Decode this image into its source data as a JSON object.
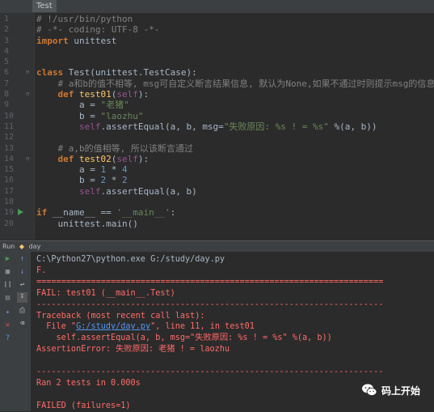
{
  "tab": {
    "label": "Test"
  },
  "editor": {
    "line_numbers": [
      "1",
      "2",
      "3",
      "4",
      "5",
      "6",
      "7",
      "8",
      "9",
      "10",
      "11",
      "12",
      "13",
      "14",
      "15",
      "16",
      "17",
      "18",
      "19",
      "20"
    ],
    "lines": [
      [
        {
          "c": "cm",
          "t": "# !/usr/bin/python"
        }
      ],
      [
        {
          "c": "cm",
          "t": "# -*- coding: UTF-8 -*-"
        }
      ],
      [
        {
          "c": "kw",
          "t": "import"
        },
        {
          "c": "",
          "t": " unittest"
        }
      ],
      [],
      [],
      [
        {
          "c": "kw",
          "t": "class"
        },
        {
          "c": "",
          "t": " Test(unittest.TestCase):"
        }
      ],
      [
        {
          "c": "cm",
          "t": "    # a和b的值不相等, msg可自定义断言结果信息, 默认为None,如果不通过时则提示msg的信息"
        }
      ],
      [
        {
          "c": "",
          "t": "    "
        },
        {
          "c": "kw",
          "t": "def"
        },
        {
          "c": "",
          "t": " "
        },
        {
          "c": "fn",
          "t": "test01"
        },
        {
          "c": "",
          "t": "("
        },
        {
          "c": "sf",
          "t": "self"
        },
        {
          "c": "",
          "t": "):"
        }
      ],
      [
        {
          "c": "",
          "t": "        a = "
        },
        {
          "c": "st",
          "t": "\"老猪\""
        }
      ],
      [
        {
          "c": "",
          "t": "        b = "
        },
        {
          "c": "st",
          "t": "\"laozhu\""
        }
      ],
      [
        {
          "c": "",
          "t": "        "
        },
        {
          "c": "sf",
          "t": "self"
        },
        {
          "c": "",
          "t": ".assertEqual(a, b, msg="
        },
        {
          "c": "st",
          "t": "\"失败原因: %s ! = %s\""
        },
        {
          "c": "",
          "t": " %(a, b))"
        }
      ],
      [],
      [
        {
          "c": "cm",
          "t": "    # a,b的值相等, 所以该断言通过"
        }
      ],
      [
        {
          "c": "",
          "t": "    "
        },
        {
          "c": "kw",
          "t": "def"
        },
        {
          "c": "",
          "t": " "
        },
        {
          "c": "fn",
          "t": "test02"
        },
        {
          "c": "",
          "t": "("
        },
        {
          "c": "sf",
          "t": "self"
        },
        {
          "c": "",
          "t": "):"
        }
      ],
      [
        {
          "c": "",
          "t": "        a = "
        },
        {
          "c": "nu",
          "t": "1"
        },
        {
          "c": "",
          "t": " * "
        },
        {
          "c": "nu",
          "t": "4"
        }
      ],
      [
        {
          "c": "",
          "t": "        b = "
        },
        {
          "c": "nu",
          "t": "2"
        },
        {
          "c": "",
          "t": " * "
        },
        {
          "c": "nu",
          "t": "2"
        }
      ],
      [
        {
          "c": "",
          "t": "        "
        },
        {
          "c": "sf",
          "t": "self"
        },
        {
          "c": "",
          "t": ".assertEqual(a, b)"
        }
      ],
      [],
      [
        {
          "c": "kw",
          "t": "if"
        },
        {
          "c": "",
          "t": " __name__ == "
        },
        {
          "c": "st",
          "t": "'__main__'"
        },
        {
          "c": "",
          "t": ":"
        }
      ],
      [
        {
          "c": "",
          "t": "    unittest.main()"
        }
      ]
    ]
  },
  "run_panel": {
    "run_label": "Run",
    "config_name": "day"
  },
  "console": {
    "lines": [
      {
        "t": "C:\\Python27\\python.exe G:/study/day.py",
        "c": ""
      },
      {
        "t": "F.",
        "c": "err"
      },
      {
        "t": "======================================================================",
        "c": "err"
      },
      {
        "t": "FAIL: test01 (__main__.Test)",
        "c": "err"
      },
      {
        "t": "----------------------------------------------------------------------",
        "c": "err"
      },
      {
        "t": "Traceback (most recent call last):",
        "c": "err"
      },
      {
        "t": "  File \"",
        "c": "err",
        "link": "G:/study/day.py",
        "after": "\", line 11, in test01"
      },
      {
        "t": "    self.assertEqual(a, b, msg=\"失败原因: %s ! = %s\" %(a, b))",
        "c": "err"
      },
      {
        "t": "AssertionError: 失败原因: 老猪 ! = laozhu",
        "c": "err"
      },
      {
        "t": "",
        "c": ""
      },
      {
        "t": "----------------------------------------------------------------------",
        "c": "err"
      },
      {
        "t": "Ran 2 tests in 0.000s",
        "c": "err"
      },
      {
        "t": "",
        "c": ""
      },
      {
        "t": "FAILED (failures=1)",
        "c": "err"
      }
    ]
  },
  "watermark": {
    "text": "码上开始"
  },
  "colors": {
    "background": "#2b2b2b",
    "gutter": "#313335",
    "keyword": "#cc7832",
    "string": "#6a8759",
    "error": "#ff6b68",
    "link": "#5394ec"
  }
}
